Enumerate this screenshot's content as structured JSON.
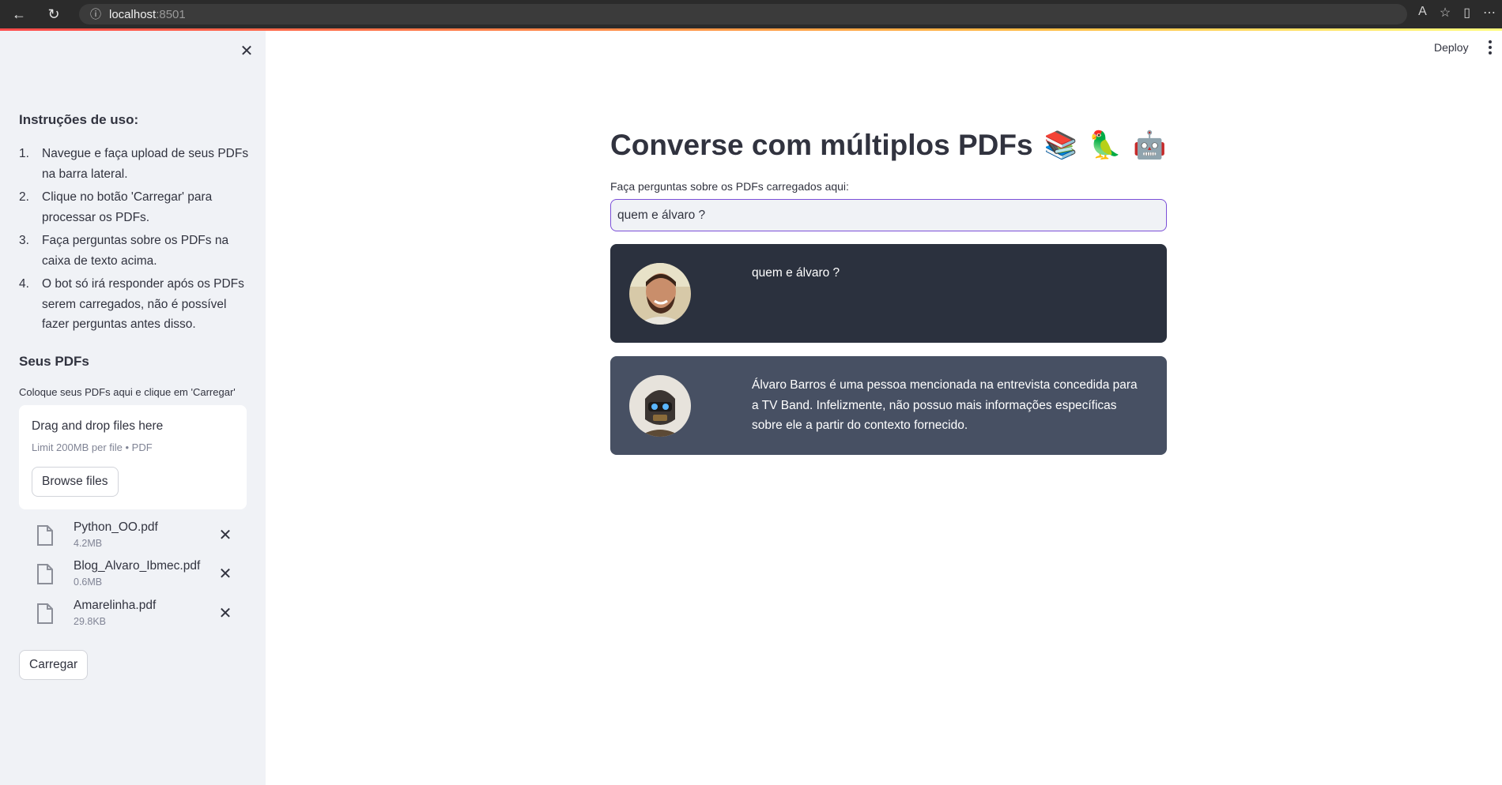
{
  "browser": {
    "url_host": "localhost",
    "url_port": ":8501"
  },
  "sidebar": {
    "instructions_title": "Instruções de uso:",
    "instructions": [
      {
        "num": "1.",
        "text": "Navegue e faça upload de seus PDFs na barra lateral."
      },
      {
        "num": "2.",
        "text": "Clique no botão 'Carregar' para processar os PDFs."
      },
      {
        "num": "3.",
        "text": "Faça perguntas sobre os PDFs na caixa de texto acima."
      },
      {
        "num": "4.",
        "text": "O bot só irá responder após os PDFs serem carregados, não é possível fazer perguntas antes disso."
      }
    ],
    "pdfs_title": "Seus PDFs",
    "uploader_caption": "Coloque seus PDFs aqui e clique em 'Carregar'",
    "dropzone": {
      "title": "Drag and drop files here",
      "limit": "Limit 200MB per file • PDF",
      "browse_label": "Browse files"
    },
    "files": [
      {
        "name": "Python_OO.pdf",
        "size": "4.2MB"
      },
      {
        "name": "Blog_Alvaro_Ibmec.pdf",
        "size": "0.6MB"
      },
      {
        "name": "Amarelinha.pdf",
        "size": "29.8KB"
      }
    ],
    "load_label": "Carregar"
  },
  "header": {
    "deploy_label": "Deploy"
  },
  "main": {
    "title": "Converse com múltiplos PDFs",
    "emojis": [
      "📚",
      "🦜",
      "🤖"
    ],
    "question_label": "Faça perguntas sobre os PDFs carregados aqui:",
    "question_value": "quem e álvaro ?",
    "messages": [
      {
        "role": "user",
        "text": "quem e álvaro ?"
      },
      {
        "role": "bot",
        "text": "Álvaro Barros é uma pessoa mencionada na entrevista concedida para a TV Band. Infelizmente, não possuo mais informações específicas sobre ele a partir do contexto fornecido."
      }
    ]
  },
  "colors": {
    "sidebar_bg": "#f0f2f6",
    "user_msg_bg": "#2b313e",
    "bot_msg_bg": "#475063",
    "input_focus": "#7b4fd8"
  }
}
